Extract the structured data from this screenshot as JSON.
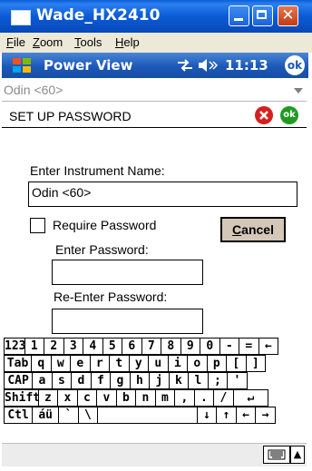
{
  "window": {
    "title": "Wade_HX2410"
  },
  "menubar": {
    "items": [
      {
        "u": "F",
        "rest": "ile"
      },
      {
        "u": "Z",
        "rest": "oom"
      },
      {
        "u": "T",
        "rest": "ools"
      },
      {
        "u": "H",
        "rest": "elp"
      }
    ]
  },
  "nav": {
    "title": "Power View",
    "time": "11:13",
    "ok_label": "ok"
  },
  "dropdown": {
    "value": "Odin <60>"
  },
  "dialog": {
    "title": "SET UP PASSWORD",
    "confirm_label": "ok",
    "name_label": "Enter Instrument Name:",
    "name_value": "Odin <60>",
    "require_label": "Require Password",
    "require_checked": false,
    "cancel_u": "C",
    "cancel_rest": "ancel",
    "password_label": "Enter Password:",
    "password_value": "",
    "reenter_label": "Re-Enter Password:",
    "reenter_value": ""
  },
  "keyboard": {
    "rows": [
      [
        "123",
        "1",
        "2",
        "3",
        "4",
        "5",
        "6",
        "7",
        "8",
        "9",
        "0",
        "-",
        "=",
        "←"
      ],
      [
        "Tab",
        "q",
        "w",
        "e",
        "r",
        "t",
        "y",
        "u",
        "i",
        "o",
        "p",
        "[",
        "]"
      ],
      [
        "CAP",
        "a",
        "s",
        "d",
        "f",
        "g",
        "h",
        "j",
        "k",
        "l",
        ";",
        "'"
      ],
      [
        "Shift",
        "z",
        "x",
        "c",
        "v",
        "b",
        "n",
        "m",
        ",",
        ".",
        "/",
        "↵"
      ],
      [
        "Ctl",
        "áü",
        "`",
        "\\",
        "",
        "↓",
        "↑",
        "←",
        "→"
      ]
    ]
  }
}
